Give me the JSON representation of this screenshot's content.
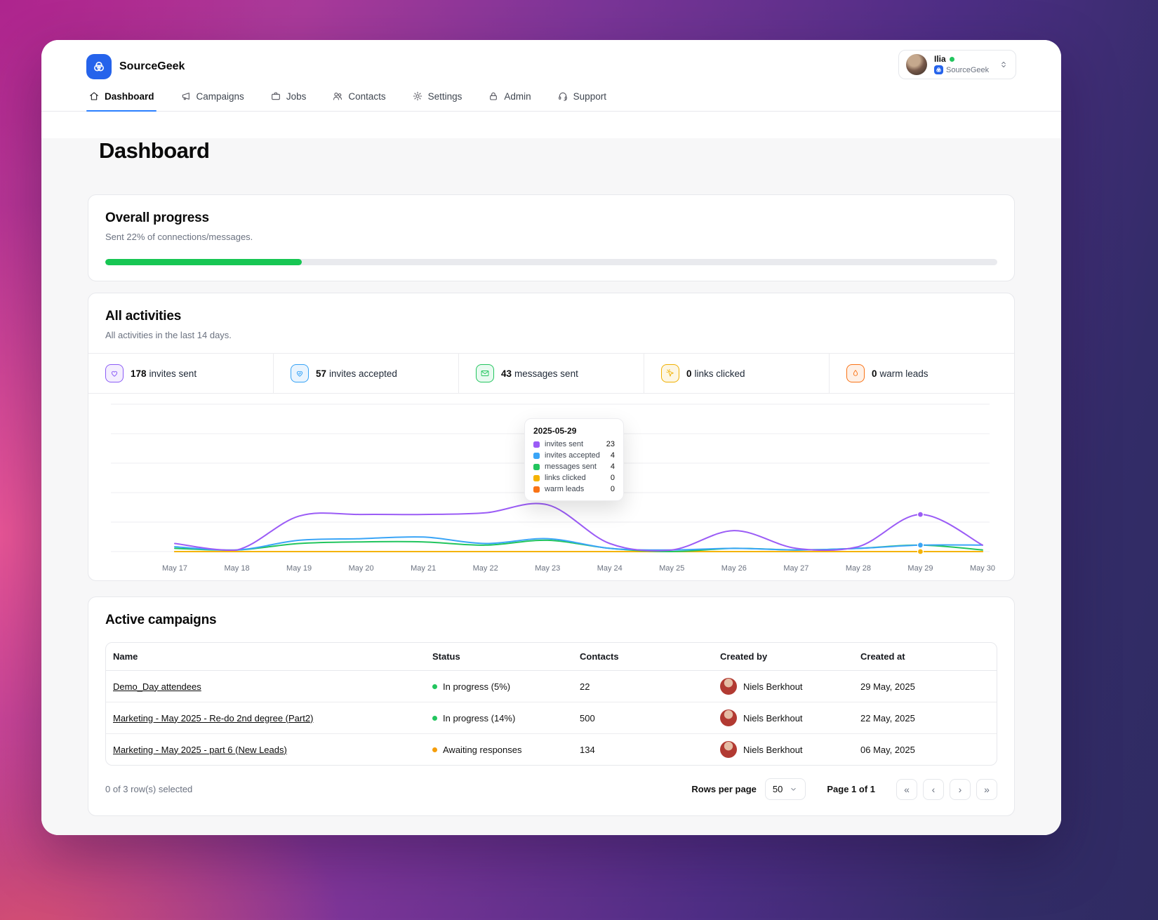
{
  "app": {
    "name": "SourceGeek"
  },
  "user": {
    "name": "Ilia",
    "org": "SourceGeek"
  },
  "nav": {
    "items": [
      {
        "label": "Dashboard"
      },
      {
        "label": "Campaigns"
      },
      {
        "label": "Jobs"
      },
      {
        "label": "Contacts"
      },
      {
        "label": "Settings"
      },
      {
        "label": "Admin"
      },
      {
        "label": "Support"
      }
    ]
  },
  "page": {
    "title": "Dashboard"
  },
  "overall_progress": {
    "title": "Overall progress",
    "subtitle": "Sent 22% of connections/messages.",
    "percent": 22,
    "bar_color": "#17c653"
  },
  "activities": {
    "title": "All activities",
    "subtitle": "All activities in the last 14 days.",
    "stats": [
      {
        "value": "178",
        "label": "invites sent",
        "color": "#8b5cf6",
        "bg": "#f4eefe"
      },
      {
        "value": "57",
        "label": "invites accepted",
        "color": "#35a2f5",
        "bg": "#e9f4fe"
      },
      {
        "value": "43",
        "label": "messages sent",
        "color": "#22c55e",
        "bg": "#e8faf0"
      },
      {
        "value": "0",
        "label": "links clicked",
        "color": "#f0b000",
        "bg": "#fdf6e3"
      },
      {
        "value": "0",
        "label": "warm leads",
        "color": "#f97316",
        "bg": "#fef0e6"
      }
    ]
  },
  "chart_data": {
    "type": "line",
    "title": "All activities (last 14 days)",
    "x": [
      "May 17",
      "May 18",
      "May 19",
      "May 20",
      "May 21",
      "May 22",
      "May 23",
      "May 24",
      "May 25",
      "May 26",
      "May 27",
      "May 28",
      "May 29",
      "May 30"
    ],
    "series": [
      {
        "name": "invites sent",
        "color": "#9b5cf6",
        "values": [
          5,
          1,
          22,
          23,
          23,
          24,
          29,
          5,
          1,
          13,
          2,
          3,
          23,
          4
        ]
      },
      {
        "name": "invites accepted",
        "color": "#3aa5f7",
        "values": [
          3,
          1,
          7,
          8,
          9,
          5,
          8,
          2,
          1,
          2,
          1,
          2,
          4,
          4
        ]
      },
      {
        "name": "messages sent",
        "color": "#22c55e",
        "values": [
          2,
          1,
          5,
          6,
          6,
          4,
          7,
          2,
          0,
          2,
          1,
          2,
          4,
          1
        ]
      },
      {
        "name": "links clicked",
        "color": "#f5b301",
        "values": [
          0,
          0,
          0,
          0,
          0,
          0,
          0,
          0,
          0,
          0,
          0,
          0,
          0,
          0
        ]
      },
      {
        "name": "warm leads",
        "color": "#f97316",
        "values": [
          0,
          0,
          0,
          0,
          0,
          0,
          0,
          0,
          0,
          0,
          0,
          0,
          0,
          0
        ]
      }
    ],
    "ylim": [
      0,
      93
    ],
    "grid": true,
    "legend_position": "tooltip-only",
    "hover_index": 12,
    "tooltip": {
      "title": "2025-05-29",
      "rows": [
        {
          "label": "invites sent",
          "value": 23,
          "color": "#9b5cf6"
        },
        {
          "label": "invites accepted",
          "value": 4,
          "color": "#3aa5f7"
        },
        {
          "label": "messages sent",
          "value": 4,
          "color": "#22c55e"
        },
        {
          "label": "links clicked",
          "value": 0,
          "color": "#f5b301"
        },
        {
          "label": "warm leads",
          "value": 0,
          "color": "#f97316"
        }
      ]
    }
  },
  "campaigns": {
    "title": "Active campaigns",
    "columns": [
      "Name",
      "Status",
      "Contacts",
      "Created by",
      "Created at"
    ],
    "rows": [
      {
        "name": "Demo_Day attendees",
        "status": "In progress (5%)",
        "status_color": "#22c55e",
        "contacts": "22",
        "created_by": "Niels Berkhout",
        "created_at": "29 May, 2025"
      },
      {
        "name": "Marketing - May 2025 - Re-do 2nd degree (Part2)",
        "status": "In progress (14%)",
        "status_color": "#22c55e",
        "contacts": "500",
        "created_by": "Niels Berkhout",
        "created_at": "22 May, 2025"
      },
      {
        "name": "Marketing - May 2025 - part 6 (New Leads)",
        "status": "Awaiting responses",
        "status_color": "#f59e0b",
        "contacts": "134",
        "created_by": "Niels Berkhout",
        "created_at": "06 May, 2025"
      }
    ],
    "footer": {
      "selected": "0 of 3 row(s) selected",
      "rows_per_page_label": "Rows per page",
      "rows_per_page_value": "50",
      "page_label": "Page 1 of 1",
      "pagination": [
        "«",
        "‹",
        "›",
        "»"
      ]
    }
  }
}
